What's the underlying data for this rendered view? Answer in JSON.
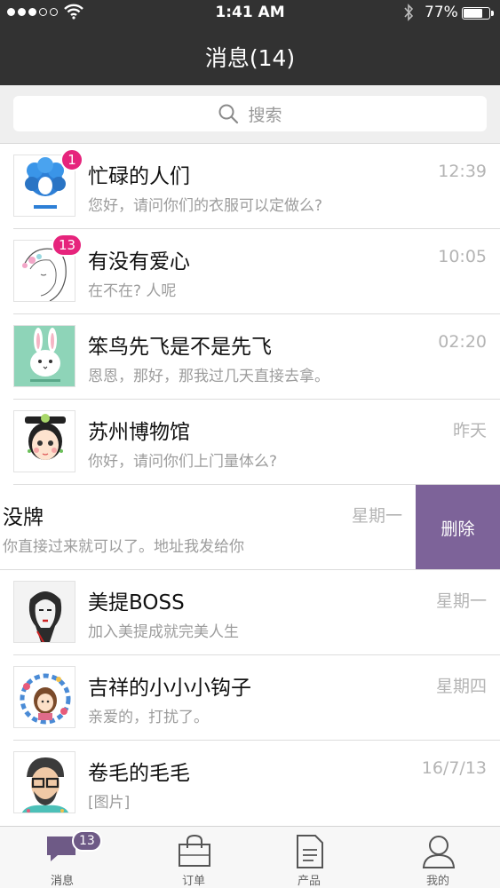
{
  "status_bar": {
    "time": "1:41 AM",
    "battery": "77%",
    "battery_level": 0.77
  },
  "nav": {
    "title": "消息(14)"
  },
  "search": {
    "placeholder": "搜索"
  },
  "conversations": [
    {
      "name": "忙碌的人们",
      "preview": "您好，请问你们的衣服可以定做么?",
      "time": "12:39",
      "badge": "1"
    },
    {
      "name": "有没有爱心",
      "preview": "在不在? 人呢",
      "time": "10:05",
      "badge": "13"
    },
    {
      "name": "笨鸟先飞是不是先飞",
      "preview": "恩恩，那好，那我过几天直接去拿。",
      "time": "02:20"
    },
    {
      "name": "苏州博物馆",
      "preview": "你好，请问你们上门量体么?",
      "time": "昨天"
    },
    {
      "name": "没牌",
      "preview": "你直接过来就可以了。地址我发给你",
      "time": "星期一",
      "delete_label": "删除"
    },
    {
      "name": "美提BOSS",
      "preview": "加入美提成就完美人生",
      "time": "星期一"
    },
    {
      "name": "吉祥的小小小钩子",
      "preview": "亲爱的，打扰了。",
      "time": "星期四"
    },
    {
      "name": "卷毛的毛毛",
      "preview": "[图片]",
      "time": "16/7/13"
    }
  ],
  "tabbar": {
    "messages": {
      "label": "消息",
      "badge": "13"
    },
    "orders": {
      "label": "订单"
    },
    "products": {
      "label": "产品"
    },
    "me": {
      "label": "我的"
    }
  },
  "colors": {
    "nav_bg": "#323232",
    "badge": "#e6247c",
    "delete_bg": "#7d6399",
    "tab_badge": "#6e5a86"
  }
}
